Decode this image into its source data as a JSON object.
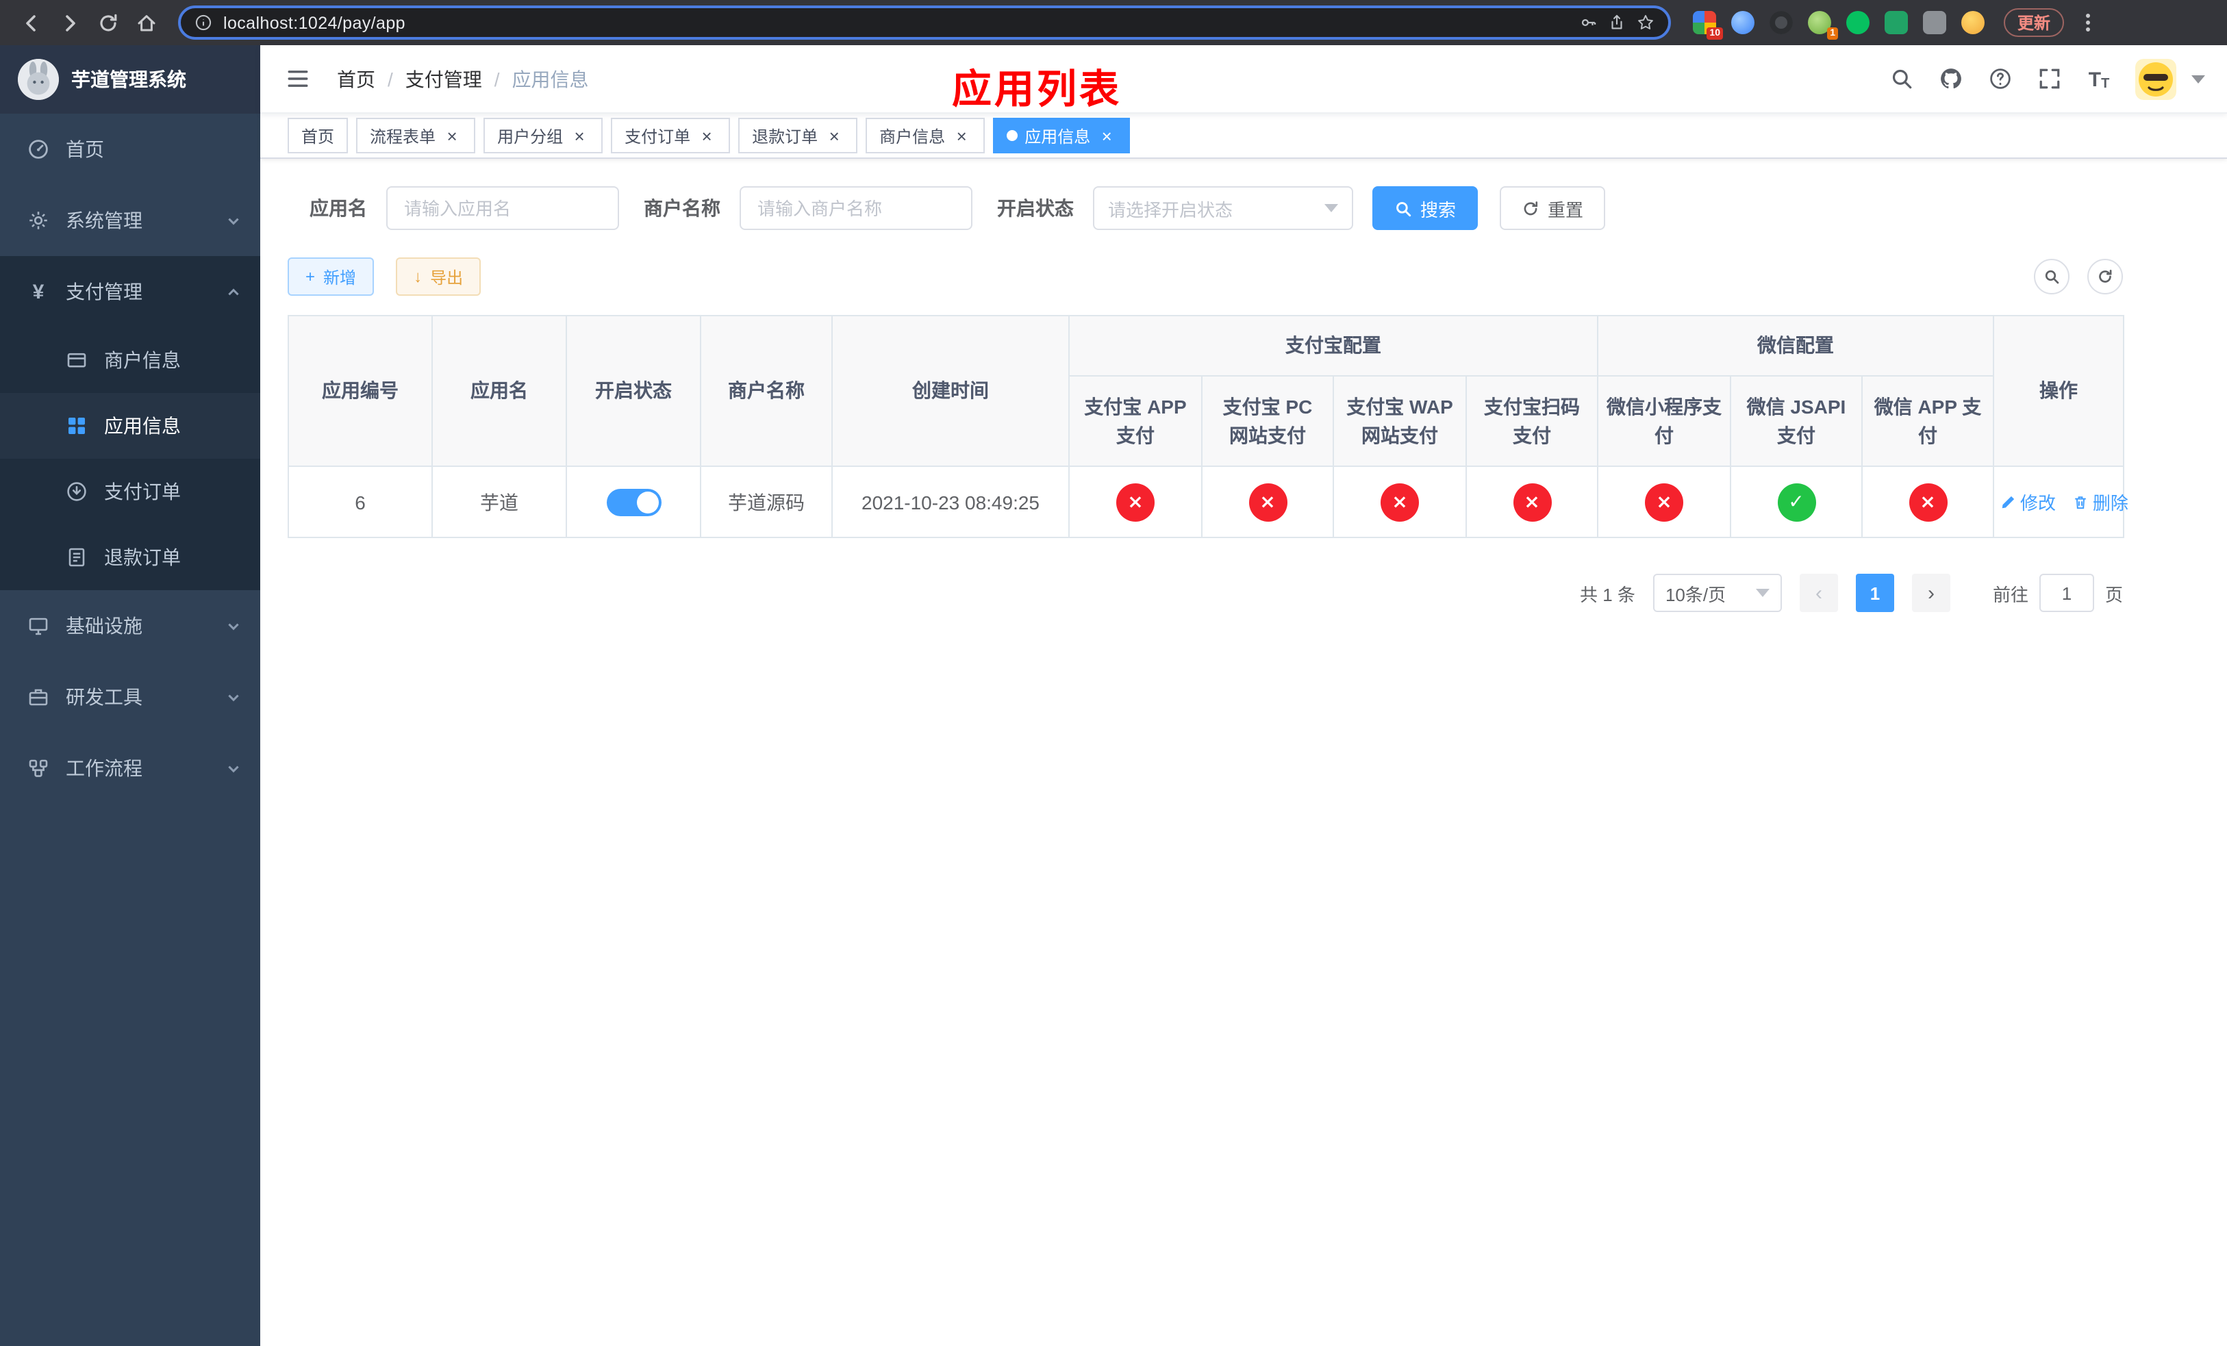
{
  "colors": {
    "primary": "#409eff",
    "success": "#22c346",
    "danger": "#f5222d",
    "warning": "#e6a23c",
    "overlay_title": "#fd0000"
  },
  "browser": {
    "url": "localhost:1024/pay/app",
    "update_label": "更新",
    "extensions_badge": "10",
    "avatar_badge": "1"
  },
  "sidebar": {
    "title": "芋道管理系统",
    "items": [
      {
        "label": "首页",
        "icon": "dashboard-icon"
      },
      {
        "label": "系统管理",
        "icon": "gear-icon"
      },
      {
        "label": "支付管理",
        "icon": "yuan-icon",
        "expanded": true,
        "children": [
          {
            "label": "商户信息",
            "icon": "card-icon"
          },
          {
            "label": "应用信息",
            "icon": "grid-icon",
            "active": true
          },
          {
            "label": "支付订单",
            "icon": "order-icon"
          },
          {
            "label": "退款订单",
            "icon": "document-icon"
          }
        ]
      },
      {
        "label": "基础设施",
        "icon": "monitor-icon"
      },
      {
        "label": "研发工具",
        "icon": "toolbox-icon"
      },
      {
        "label": "工作流程",
        "icon": "workflow-icon"
      }
    ]
  },
  "header": {
    "breadcrumb": [
      "首页",
      "支付管理",
      "应用信息"
    ],
    "overlay_title": "应用列表"
  },
  "tabs": [
    {
      "label": "首页",
      "closable": false,
      "active": false
    },
    {
      "label": "流程表单",
      "closable": true,
      "active": false
    },
    {
      "label": "用户分组",
      "closable": true,
      "active": false
    },
    {
      "label": "支付订单",
      "closable": true,
      "active": false
    },
    {
      "label": "退款订单",
      "closable": true,
      "active": false
    },
    {
      "label": "商户信息",
      "closable": true,
      "active": false
    },
    {
      "label": "应用信息",
      "closable": true,
      "active": true
    }
  ],
  "filters": {
    "app_name_label": "应用名",
    "app_name_placeholder": "请输入应用名",
    "merchant_label": "商户名称",
    "merchant_placeholder": "请输入商户名称",
    "status_label": "开启状态",
    "status_placeholder": "请选择开启状态",
    "search_label": "搜索",
    "reset_label": "重置"
  },
  "toolbar": {
    "add_label": "新增",
    "export_label": "导出"
  },
  "table": {
    "group_headers": {
      "alipay": "支付宝配置",
      "wechat": "微信配置"
    },
    "columns": [
      "应用编号",
      "应用名",
      "开启状态",
      "商户名称",
      "创建时间",
      "支付宝 APP 支付",
      "支付宝 PC 网站支付",
      "支付宝 WAP 网站支付",
      "支付宝扫码支付",
      "微信小程序支付",
      "微信 JSAPI 支付",
      "微信 APP 支付",
      "操作"
    ],
    "rows": [
      {
        "id": "6",
        "name": "芋道",
        "enabled": true,
        "merchant": "芋道源码",
        "created": "2021-10-23 08:49:25",
        "alipay_app": false,
        "alipay_pc": false,
        "alipay_wap": false,
        "alipay_qr": false,
        "wx_mini": false,
        "wx_jsapi": true,
        "wx_app": false,
        "edit_label": "修改",
        "delete_label": "删除"
      }
    ]
  },
  "pagination": {
    "total": "共 1 条",
    "page_size": "10条/页",
    "page": "1",
    "goto_label": "前往",
    "goto_value": "1",
    "unit_label": "页"
  },
  "glyphs": {
    "close": "×",
    "pass": "✓",
    "fail": "×",
    "sep": "/",
    "prev": "‹",
    "next": "›",
    "plus": "+",
    "download": "↓",
    "yuan": "¥",
    "font_large": "T",
    "font_small": "T"
  }
}
